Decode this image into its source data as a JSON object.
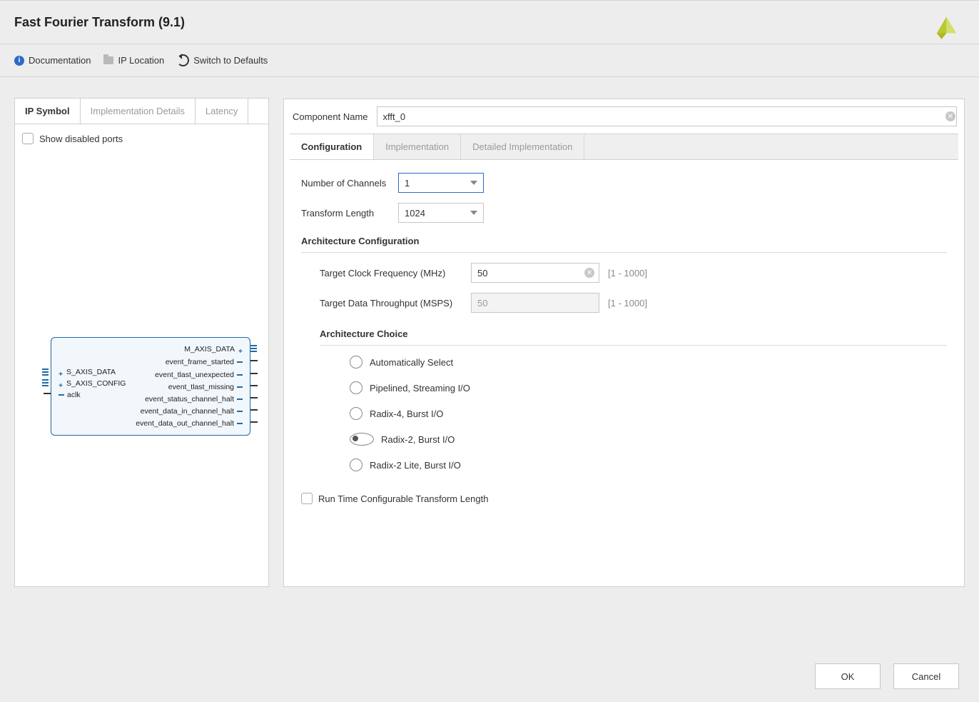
{
  "title": "Fast Fourier Transform (9.1)",
  "toolbar": {
    "doc": "Documentation",
    "ip_loc": "IP Location",
    "defaults": "Switch to Defaults"
  },
  "left_tabs": {
    "symbol": "IP Symbol",
    "impl": "Implementation Details",
    "lat": "Latency"
  },
  "show_disabled": "Show disabled ports",
  "ip_ports": {
    "left": [
      "S_AXIS_DATA",
      "S_AXIS_CONFIG",
      "aclk"
    ],
    "right": [
      "M_AXIS_DATA",
      "event_frame_started",
      "event_tlast_unexpected",
      "event_tlast_missing",
      "event_status_channel_halt",
      "event_data_in_channel_halt",
      "event_data_out_channel_halt"
    ]
  },
  "comp_name_label": "Component Name",
  "comp_name_value": "xfft_0",
  "cfg_tabs": {
    "cfg": "Configuration",
    "impl": "Implementation",
    "det": "Detailed Implementation"
  },
  "cfg": {
    "num_ch_label": "Number of Channels",
    "num_ch_value": "1",
    "tlen_label": "Transform Length",
    "tlen_value": "1024",
    "arch_cfg_title": "Architecture Configuration",
    "tclk_label": "Target Clock Frequency (MHz)",
    "tclk_value": "50",
    "tclk_range": "[1 - 1000]",
    "thr_label": "Target Data Throughput (MSPS)",
    "thr_value": "50",
    "thr_range": "[1 - 1000]",
    "arch_choice_title": "Architecture Choice",
    "arch_opts": [
      "Automatically Select",
      "Pipelined, Streaming I/O",
      "Radix-4, Burst I/O",
      "Radix-2, Burst I/O",
      "Radix-2 Lite, Burst I/O"
    ],
    "arch_selected": 3,
    "runtime_cfg": "Run Time Configurable Transform Length"
  },
  "footer": {
    "ok": "OK",
    "cancel": "Cancel"
  }
}
